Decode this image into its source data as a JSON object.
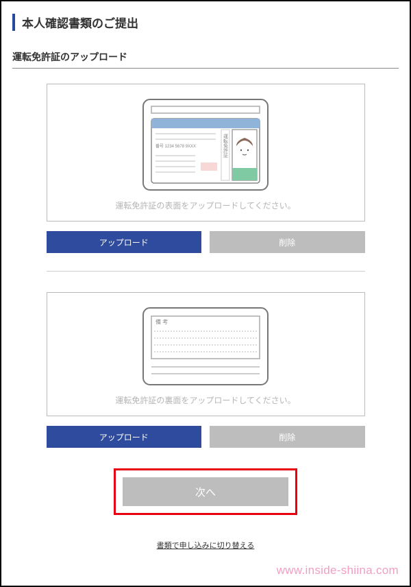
{
  "page": {
    "title": "本人確認書類のご提出",
    "section_title": "運転免許証のアップロード"
  },
  "front_card": {
    "instruction": "運転免許証の表面をアップロードしてください。",
    "license_number_label": "番号 1234 5678 9XXX",
    "license_vertical_text": "運転免許証"
  },
  "back_card": {
    "instruction": "運転免許証の裏面をアップロードしてください。",
    "remarks_label": "備 考"
  },
  "buttons": {
    "upload": "アップロード",
    "delete": "削除",
    "next": "次へ"
  },
  "link": {
    "switch_paper": "書類で申し込みに切り替える"
  },
  "watermark": "www.inside-shiina.com"
}
